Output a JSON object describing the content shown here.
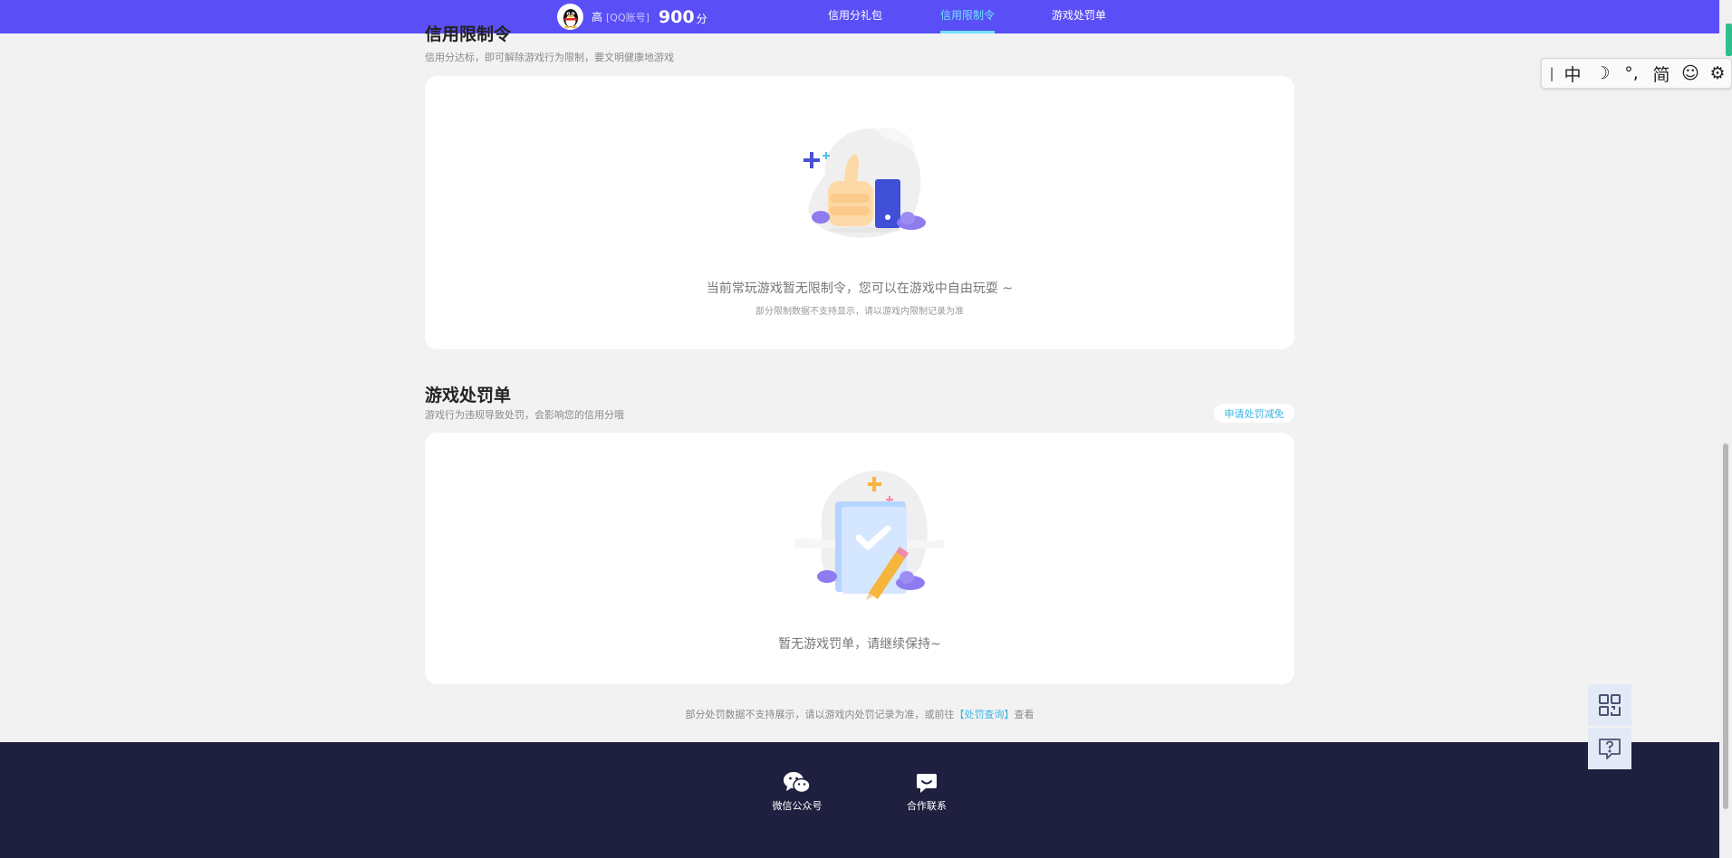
{
  "header": {
    "user_name": "高",
    "account_type": "[QQ账号]",
    "score": "900",
    "score_unit": "分",
    "tabs": [
      {
        "label": "信用分礼包",
        "active": false
      },
      {
        "label": "信用限制令",
        "active": true
      },
      {
        "label": "游戏处罚单",
        "active": false
      }
    ]
  },
  "restriction": {
    "title": "信用限制令",
    "subtitle": "信用分达标，即可解除游戏行为限制，要文明健康地游戏",
    "empty_message": "当前常玩游戏暂无限制令，您可以在游戏中自由玩耍 ~",
    "note": "部分限制数据不支持显示，请以游戏内限制记录为准"
  },
  "penalty": {
    "title": "游戏处罚单",
    "subtitle": "游戏行为违规导致处罚，会影响您的信用分哦",
    "appeal_button": "申请处罚减免",
    "empty_message": "暂无游戏罚单，请继续保持~"
  },
  "bottom_note": {
    "prefix": "部分处罚数据不支持展示，请以游戏内处罚记录为准，或前往",
    "link": "【处罚查询】",
    "suffix": "查看"
  },
  "footer": {
    "items": [
      {
        "label": "微信公众号",
        "icon": "wechat-icon"
      },
      {
        "label": "合作联系",
        "icon": "chat-bubble-icon"
      }
    ]
  },
  "float_buttons": [
    {
      "icon": "qr-code-icon"
    },
    {
      "icon": "help-question-icon"
    }
  ],
  "ime_toolbar": {
    "items": [
      "中",
      "☽",
      "°,",
      "简",
      "☺",
      "⚙"
    ]
  },
  "colors": {
    "topbar": "#5a4ff6",
    "active_tab": "#6fe1ff",
    "link": "#3fb3e3",
    "footer": "#1f1f3f",
    "page_bg": "#f2f2f2"
  }
}
